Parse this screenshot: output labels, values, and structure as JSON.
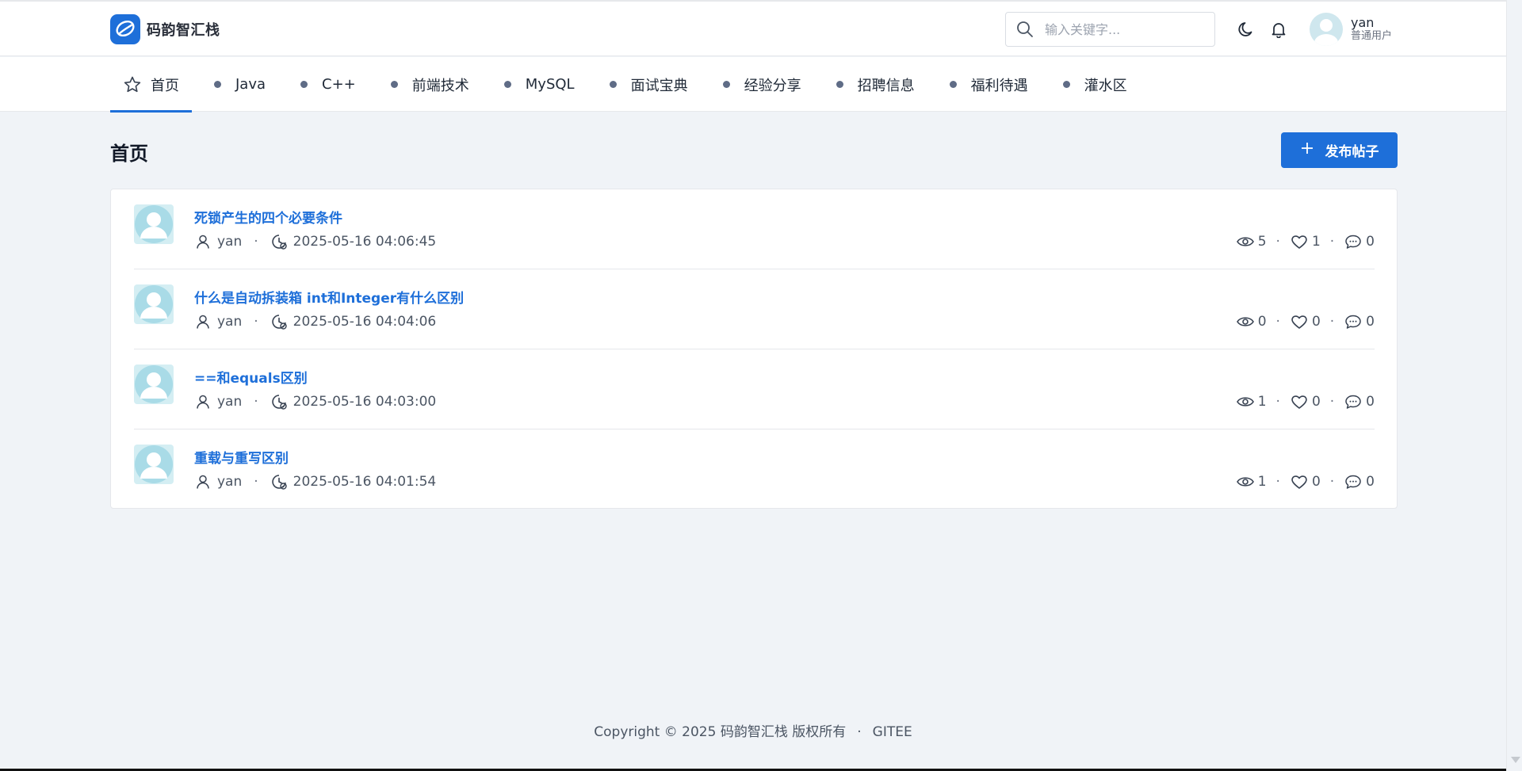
{
  "app": {
    "name": "码韵智汇栈",
    "accent_color": "#1e6fd9"
  },
  "header": {
    "logo_icon": "leaf-logo-icon",
    "search": {
      "placeholder": "输入关键字..."
    },
    "theme_icon": "moon-icon",
    "notification_icon": "bell-icon",
    "user": {
      "name": "yan",
      "role": "普通用户"
    }
  },
  "nav": {
    "items": [
      {
        "label": "首页",
        "icon": "star-icon",
        "active": true
      },
      {
        "label": "Java"
      },
      {
        "label": "C++"
      },
      {
        "label": "前端技术"
      },
      {
        "label": "MySQL"
      },
      {
        "label": "面试宝典"
      },
      {
        "label": "经验分享"
      },
      {
        "label": "招聘信息"
      },
      {
        "label": "福利待遇"
      },
      {
        "label": "灌水区"
      }
    ]
  },
  "main": {
    "title": "首页",
    "publish_button": {
      "plus": "+",
      "label": "发布帖子"
    },
    "posts": [
      {
        "title": "死锁产生的四个必要条件",
        "author": "yan",
        "time": "2025-05-16 04:06:45",
        "views": "5",
        "likes": "1",
        "comments": "0"
      },
      {
        "title": "什么是自动拆装箱 int和Integer有什么区别",
        "author": "yan",
        "time": "2025-05-16 04:04:06",
        "views": "0",
        "likes": "0",
        "comments": "0"
      },
      {
        "title": "==和equals区别",
        "author": "yan",
        "time": "2025-05-16 04:03:00",
        "views": "1",
        "likes": "0",
        "comments": "0"
      },
      {
        "title": "重载与重写区别",
        "author": "yan",
        "time": "2025-05-16 04:01:54",
        "views": "1",
        "likes": "0",
        "comments": "0"
      }
    ],
    "separator": "·"
  },
  "footer": {
    "copyright": "Copyright © 2025 码韵智汇栈 版权所有",
    "separator": "·",
    "link": "GITEE"
  }
}
